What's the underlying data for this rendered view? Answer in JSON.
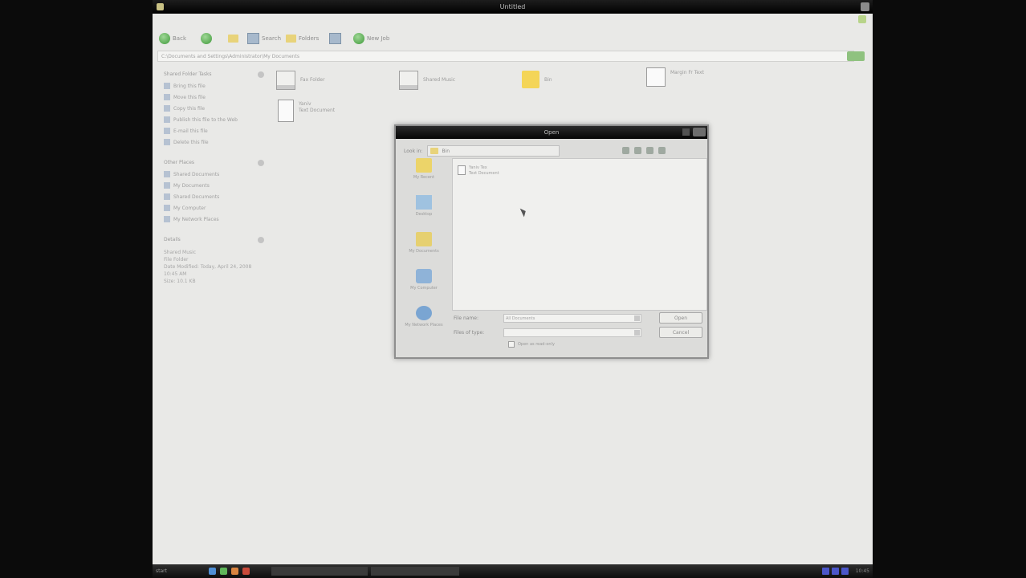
{
  "window": {
    "title": "Untitled"
  },
  "toolbar": {
    "back_label": "Back",
    "search_label": "Search",
    "folders_label": "Folders",
    "views_label": "",
    "new_label": "New Job"
  },
  "address": {
    "value": "C:\\Documents and Settings\\Administrator\\My Documents"
  },
  "leftpane": {
    "tasks_header": "Shared Folder Tasks",
    "tasks": [
      "Bring this file",
      "Move this file",
      "Copy this file",
      "Publish this file to the Web",
      "E-mail this file",
      "Delete this file"
    ],
    "places_header": "Other Places",
    "places": [
      "Shared Documents",
      "My Documents",
      "Shared Documents",
      "My Computer",
      "My Network Places"
    ],
    "details_header": "Details",
    "details_lines": [
      "Shared Music",
      "File Folder",
      "Date Modified: Today, April 24, 2008",
      "10:45 AM",
      "Size: 10.1 KB"
    ]
  },
  "main": {
    "items": [
      {
        "name": "Fax Folder",
        "icon": "drive-icon"
      },
      {
        "name": "Shared Music",
        "icon": "drive-icon"
      },
      {
        "name": "Bin",
        "icon": "folder-icon"
      },
      {
        "name": "Margin Fr Text",
        "icon": "document-icon"
      },
      {
        "name": "Yaniv",
        "sub": "Text Document",
        "icon": "document-icon"
      }
    ]
  },
  "dialog": {
    "title": "Open",
    "lookin_label": "Look in:",
    "lookin_value": "Bin",
    "places": [
      "My Recent",
      "Desktop",
      "My Documents",
      "My Computer",
      "My Network Places"
    ],
    "file_entry": [
      "Yaniv Tex",
      "Text Document"
    ],
    "filename_label": "File name:",
    "filename_value": "All Documents",
    "filetype_label": "Files of type:",
    "filetype_value": "",
    "open_button": "Open",
    "cancel_button": "Cancel",
    "readonly_label": "Open as read-only"
  },
  "taskbar": {
    "start": "start",
    "clock": "10:45"
  }
}
